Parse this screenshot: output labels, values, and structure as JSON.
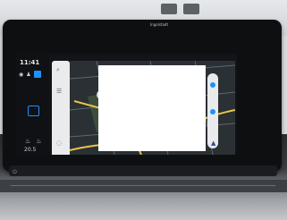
{
  "status_bar": {
    "time": "11:41"
  },
  "sidebar": {
    "icons": [
      {
        "name": "wireless-icon",
        "glyph": "◉"
      },
      {
        "name": "person-icon",
        "glyph": "♟"
      }
    ],
    "temperature": "20.5",
    "seat_icons": [
      "seat-heat-left-icon",
      "seat-heat-right-icon"
    ]
  },
  "search_panel": {
    "icons": [
      "search-icon",
      "menu-icon",
      "location-pin-icon"
    ]
  },
  "map": {
    "label": "Ingolstadt",
    "colors": {
      "road_yellow": "#e8c34a",
      "park": "#3c4d3e",
      "background": "#2a3034"
    }
  },
  "controls": {
    "accent_color": "#1e90ff"
  }
}
